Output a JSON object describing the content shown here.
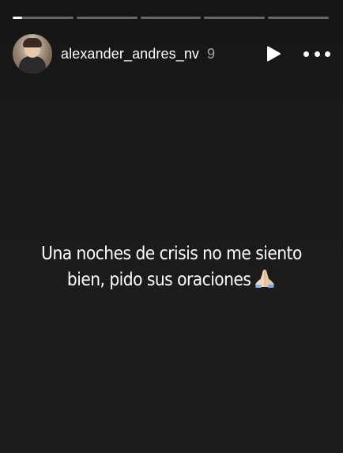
{
  "story": {
    "progress": {
      "segments": 5,
      "active_index": 0,
      "active_fill_percent": 15
    },
    "header": {
      "username": "alexander_andres_nv",
      "time_ago": "9",
      "avatar_icon": "profile-avatar",
      "play_icon": "play-icon",
      "more_icon": "more-dots-icon"
    },
    "caption": {
      "line1": "Una noches de crisis no me siento",
      "line2": "bien, pido sus oraciones",
      "emoji_icon": "praying-hands-icon"
    },
    "colors": {
      "background": "#1b1b1b",
      "text": "#ffffff",
      "progress_track": "rgba(255,255,255,0.35)",
      "progress_fill": "#ffffff"
    }
  }
}
